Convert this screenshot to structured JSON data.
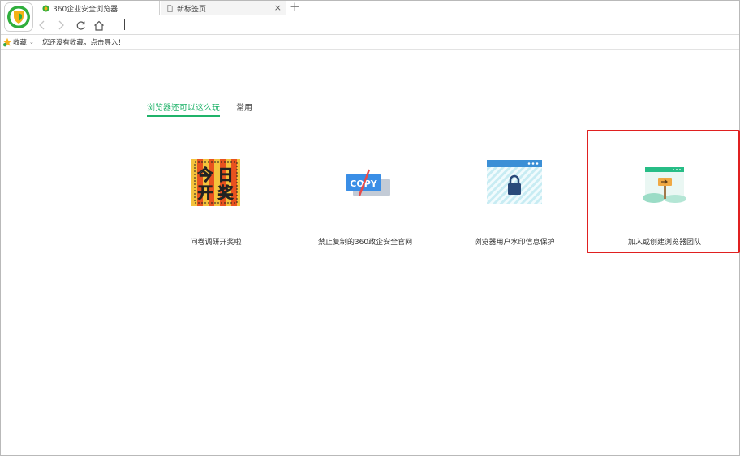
{
  "tabs": [
    {
      "title": "360企业安全浏览器",
      "icon": "browser-logo-icon"
    },
    {
      "title": "新标签页",
      "icon": "page-icon",
      "close": "×"
    }
  ],
  "new_tab_symbol": "+",
  "toolbar": {
    "back": "back-icon",
    "forward": "forward-icon",
    "refresh": "refresh-icon",
    "home": "home-icon"
  },
  "favbar": {
    "label": "收藏",
    "chevron": "⌄",
    "hint": "您还没有收藏，点击导入！"
  },
  "content_tabs": [
    {
      "label": "浏览器还可以这么玩",
      "active": true
    },
    {
      "label": "常用",
      "active": false
    }
  ],
  "cards": [
    {
      "label": "问卷调研开奖啦",
      "icon": "lottery-icon",
      "thumb_text": [
        "今",
        "日",
        "开",
        "奖"
      ]
    },
    {
      "label": "禁止复制的360政企安全官网",
      "icon": "no-copy-icon",
      "thumb_text": [
        "COPY"
      ]
    },
    {
      "label": "浏览器用户水印信息保护",
      "icon": "watermark-lock-icon"
    },
    {
      "label": "加入或创建浏览器团队",
      "icon": "team-signpost-icon"
    }
  ],
  "colors": {
    "accent": "#20b36a",
    "highlight": "#e02020"
  }
}
